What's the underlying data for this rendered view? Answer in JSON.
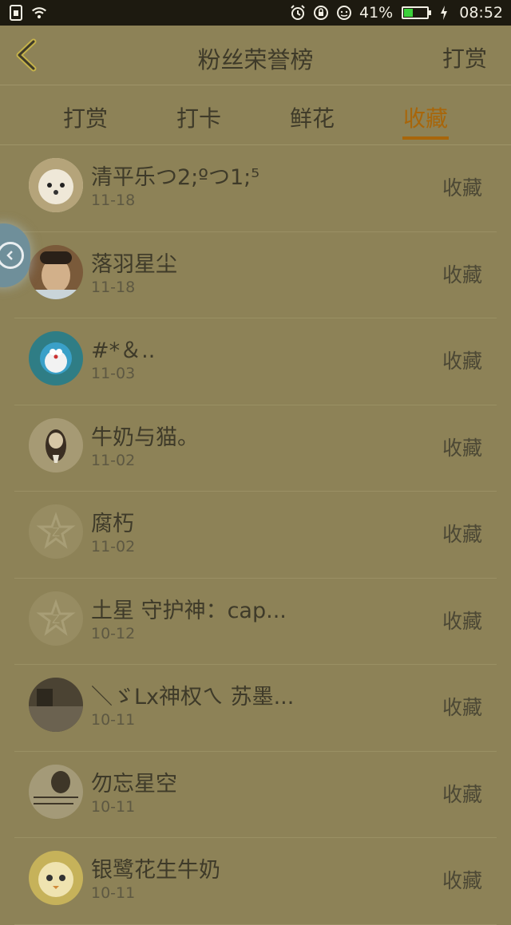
{
  "status_bar": {
    "battery_percent": "41%",
    "battery_level": 0.41,
    "time": "08:52",
    "icons": [
      "sim-icon",
      "wifi-icon",
      "alarm-icon",
      "rotation-lock-icon",
      "face-icon",
      "battery-icon",
      "charging-icon"
    ]
  },
  "header": {
    "title": "粉丝荣誉榜",
    "action_label": "打赏",
    "back_icon": "chevron-left-icon"
  },
  "tabs": [
    {
      "label": "打赏",
      "active": false
    },
    {
      "label": "打卡",
      "active": false
    },
    {
      "label": "鲜花",
      "active": false
    },
    {
      "label": "收藏",
      "active": true
    }
  ],
  "list": {
    "items": [
      {
        "name": "清平乐つ2;ºつ1;⁵",
        "date": "11-18",
        "action": "收藏",
        "avatar": "dog"
      },
      {
        "name": "落羽星尘",
        "date": "11-18",
        "action": "收藏",
        "avatar": "person"
      },
      {
        "name": "#*＆..",
        "date": "11-03",
        "action": "收藏",
        "avatar": "doraemon"
      },
      {
        "name": "牛奶与猫。",
        "date": "11-02",
        "action": "收藏",
        "avatar": "girl"
      },
      {
        "name": "腐朽",
        "date": "11-02",
        "action": "收藏",
        "avatar": "default"
      },
      {
        "name": "土星 守护神：cap...",
        "date": "10-12",
        "action": "收藏",
        "avatar": "default"
      },
      {
        "name": "＼ゞLx神权ㄟ 苏墨...",
        "date": "10-11",
        "action": "收藏",
        "avatar": "dark"
      },
      {
        "name": "勿忘星空",
        "date": "10-11",
        "action": "收藏",
        "avatar": "sketch"
      },
      {
        "name": "银鹭花生牛奶",
        "date": "10-11",
        "action": "收藏",
        "avatar": "cartoon"
      }
    ]
  },
  "colors": {
    "background": "#8d8257",
    "accent": "#a8660a",
    "status_bar": "#1d1a10"
  }
}
